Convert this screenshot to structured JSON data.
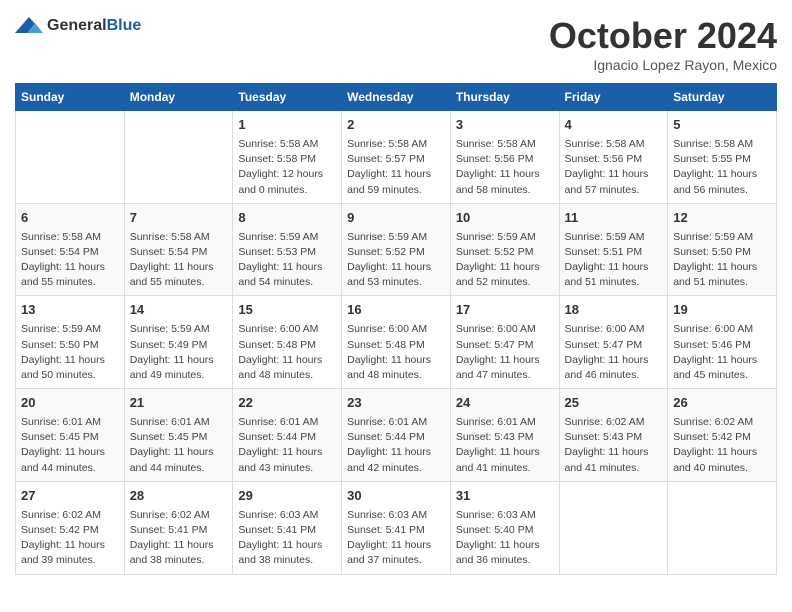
{
  "header": {
    "logo_general": "General",
    "logo_blue": "Blue",
    "month_title": "October 2024",
    "location": "Ignacio Lopez Rayon, Mexico"
  },
  "calendar": {
    "weekdays": [
      "Sunday",
      "Monday",
      "Tuesday",
      "Wednesday",
      "Thursday",
      "Friday",
      "Saturday"
    ],
    "weeks": [
      [
        {
          "day": "",
          "sunrise": "",
          "sunset": "",
          "daylight": ""
        },
        {
          "day": "",
          "sunrise": "",
          "sunset": "",
          "daylight": ""
        },
        {
          "day": "1",
          "sunrise": "Sunrise: 5:58 AM",
          "sunset": "Sunset: 5:58 PM",
          "daylight": "Daylight: 12 hours and 0 minutes."
        },
        {
          "day": "2",
          "sunrise": "Sunrise: 5:58 AM",
          "sunset": "Sunset: 5:57 PM",
          "daylight": "Daylight: 11 hours and 59 minutes."
        },
        {
          "day": "3",
          "sunrise": "Sunrise: 5:58 AM",
          "sunset": "Sunset: 5:56 PM",
          "daylight": "Daylight: 11 hours and 58 minutes."
        },
        {
          "day": "4",
          "sunrise": "Sunrise: 5:58 AM",
          "sunset": "Sunset: 5:56 PM",
          "daylight": "Daylight: 11 hours and 57 minutes."
        },
        {
          "day": "5",
          "sunrise": "Sunrise: 5:58 AM",
          "sunset": "Sunset: 5:55 PM",
          "daylight": "Daylight: 11 hours and 56 minutes."
        }
      ],
      [
        {
          "day": "6",
          "sunrise": "Sunrise: 5:58 AM",
          "sunset": "Sunset: 5:54 PM",
          "daylight": "Daylight: 11 hours and 55 minutes."
        },
        {
          "day": "7",
          "sunrise": "Sunrise: 5:58 AM",
          "sunset": "Sunset: 5:54 PM",
          "daylight": "Daylight: 11 hours and 55 minutes."
        },
        {
          "day": "8",
          "sunrise": "Sunrise: 5:59 AM",
          "sunset": "Sunset: 5:53 PM",
          "daylight": "Daylight: 11 hours and 54 minutes."
        },
        {
          "day": "9",
          "sunrise": "Sunrise: 5:59 AM",
          "sunset": "Sunset: 5:52 PM",
          "daylight": "Daylight: 11 hours and 53 minutes."
        },
        {
          "day": "10",
          "sunrise": "Sunrise: 5:59 AM",
          "sunset": "Sunset: 5:52 PM",
          "daylight": "Daylight: 11 hours and 52 minutes."
        },
        {
          "day": "11",
          "sunrise": "Sunrise: 5:59 AM",
          "sunset": "Sunset: 5:51 PM",
          "daylight": "Daylight: 11 hours and 51 minutes."
        },
        {
          "day": "12",
          "sunrise": "Sunrise: 5:59 AM",
          "sunset": "Sunset: 5:50 PM",
          "daylight": "Daylight: 11 hours and 51 minutes."
        }
      ],
      [
        {
          "day": "13",
          "sunrise": "Sunrise: 5:59 AM",
          "sunset": "Sunset: 5:50 PM",
          "daylight": "Daylight: 11 hours and 50 minutes."
        },
        {
          "day": "14",
          "sunrise": "Sunrise: 5:59 AM",
          "sunset": "Sunset: 5:49 PM",
          "daylight": "Daylight: 11 hours and 49 minutes."
        },
        {
          "day": "15",
          "sunrise": "Sunrise: 6:00 AM",
          "sunset": "Sunset: 5:48 PM",
          "daylight": "Daylight: 11 hours and 48 minutes."
        },
        {
          "day": "16",
          "sunrise": "Sunrise: 6:00 AM",
          "sunset": "Sunset: 5:48 PM",
          "daylight": "Daylight: 11 hours and 48 minutes."
        },
        {
          "day": "17",
          "sunrise": "Sunrise: 6:00 AM",
          "sunset": "Sunset: 5:47 PM",
          "daylight": "Daylight: 11 hours and 47 minutes."
        },
        {
          "day": "18",
          "sunrise": "Sunrise: 6:00 AM",
          "sunset": "Sunset: 5:47 PM",
          "daylight": "Daylight: 11 hours and 46 minutes."
        },
        {
          "day": "19",
          "sunrise": "Sunrise: 6:00 AM",
          "sunset": "Sunset: 5:46 PM",
          "daylight": "Daylight: 11 hours and 45 minutes."
        }
      ],
      [
        {
          "day": "20",
          "sunrise": "Sunrise: 6:01 AM",
          "sunset": "Sunset: 5:45 PM",
          "daylight": "Daylight: 11 hours and 44 minutes."
        },
        {
          "day": "21",
          "sunrise": "Sunrise: 6:01 AM",
          "sunset": "Sunset: 5:45 PM",
          "daylight": "Daylight: 11 hours and 44 minutes."
        },
        {
          "day": "22",
          "sunrise": "Sunrise: 6:01 AM",
          "sunset": "Sunset: 5:44 PM",
          "daylight": "Daylight: 11 hours and 43 minutes."
        },
        {
          "day": "23",
          "sunrise": "Sunrise: 6:01 AM",
          "sunset": "Sunset: 5:44 PM",
          "daylight": "Daylight: 11 hours and 42 minutes."
        },
        {
          "day": "24",
          "sunrise": "Sunrise: 6:01 AM",
          "sunset": "Sunset: 5:43 PM",
          "daylight": "Daylight: 11 hours and 41 minutes."
        },
        {
          "day": "25",
          "sunrise": "Sunrise: 6:02 AM",
          "sunset": "Sunset: 5:43 PM",
          "daylight": "Daylight: 11 hours and 41 minutes."
        },
        {
          "day": "26",
          "sunrise": "Sunrise: 6:02 AM",
          "sunset": "Sunset: 5:42 PM",
          "daylight": "Daylight: 11 hours and 40 minutes."
        }
      ],
      [
        {
          "day": "27",
          "sunrise": "Sunrise: 6:02 AM",
          "sunset": "Sunset: 5:42 PM",
          "daylight": "Daylight: 11 hours and 39 minutes."
        },
        {
          "day": "28",
          "sunrise": "Sunrise: 6:02 AM",
          "sunset": "Sunset: 5:41 PM",
          "daylight": "Daylight: 11 hours and 38 minutes."
        },
        {
          "day": "29",
          "sunrise": "Sunrise: 6:03 AM",
          "sunset": "Sunset: 5:41 PM",
          "daylight": "Daylight: 11 hours and 38 minutes."
        },
        {
          "day": "30",
          "sunrise": "Sunrise: 6:03 AM",
          "sunset": "Sunset: 5:41 PM",
          "daylight": "Daylight: 11 hours and 37 minutes."
        },
        {
          "day": "31",
          "sunrise": "Sunrise: 6:03 AM",
          "sunset": "Sunset: 5:40 PM",
          "daylight": "Daylight: 11 hours and 36 minutes."
        },
        {
          "day": "",
          "sunrise": "",
          "sunset": "",
          "daylight": ""
        },
        {
          "day": "",
          "sunrise": "",
          "sunset": "",
          "daylight": ""
        }
      ]
    ]
  }
}
